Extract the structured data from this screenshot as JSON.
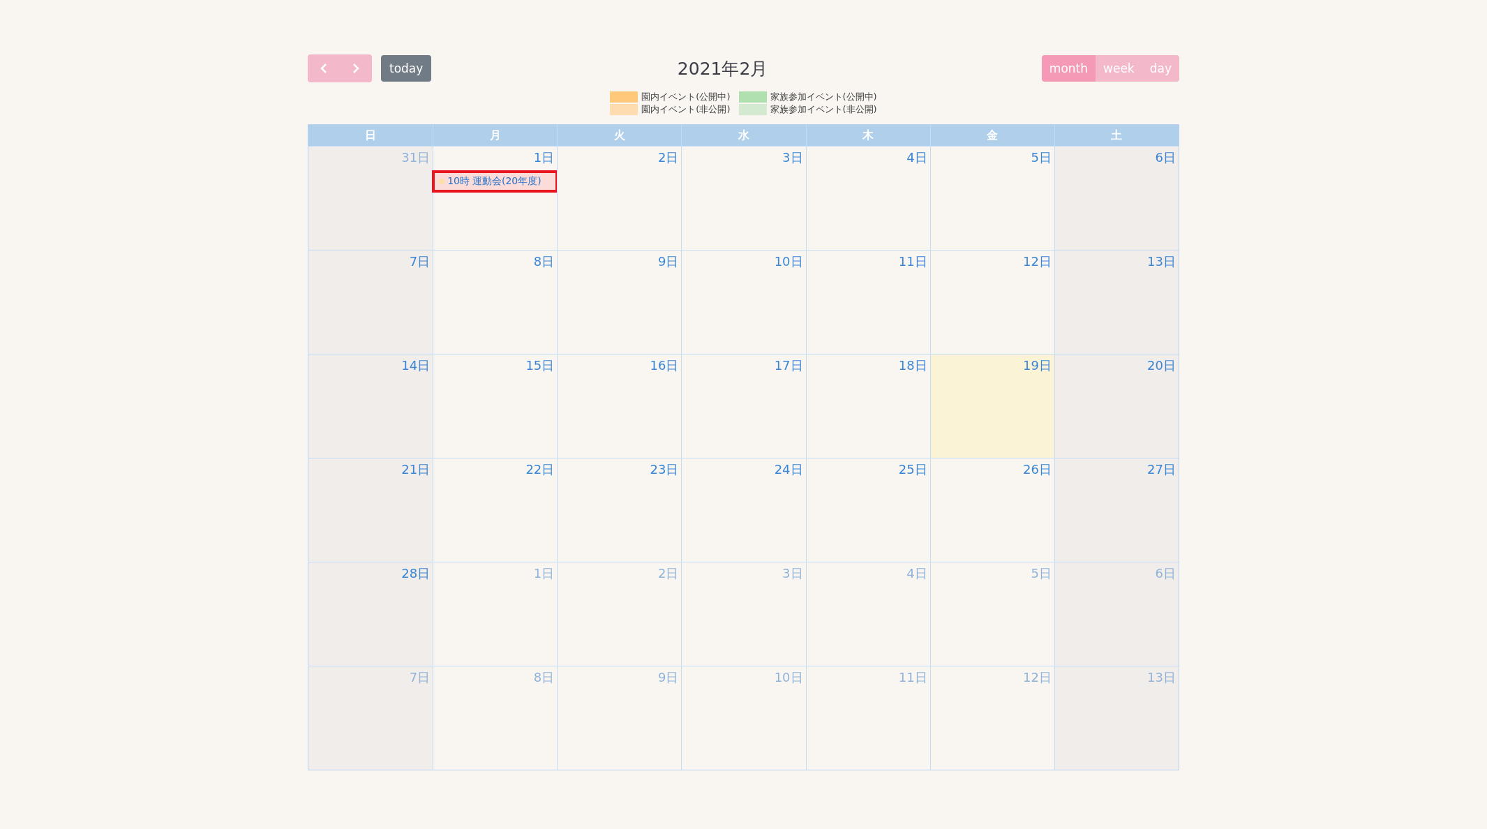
{
  "toolbar": {
    "today_button": "today",
    "title": "2021年2月",
    "views": [
      {
        "label": "month",
        "selected": true
      },
      {
        "label": "week",
        "selected": false
      },
      {
        "label": "day",
        "selected": false
      }
    ]
  },
  "legend": [
    {
      "label": "園内イベント(公開中)",
      "color": "#ffc87a"
    },
    {
      "label": "家族参加イベント(公開中)",
      "color": "#b0e0b0"
    },
    {
      "label": "園内イベント(非公開)",
      "color": "#fedcb0"
    },
    {
      "label": "家族参加イベント(非公開)",
      "color": "#d4ead0"
    }
  ],
  "weekdays": [
    "日",
    "月",
    "火",
    "水",
    "木",
    "金",
    "土"
  ],
  "weeks": [
    [
      {
        "day": "31日",
        "other_month": true,
        "today": false
      },
      {
        "day": "1日",
        "other_month": false,
        "today": false,
        "events": [
          {
            "time": "10時",
            "title": "運動会(20年度)",
            "color": "#fddfa8",
            "outlined": true
          }
        ]
      },
      {
        "day": "2日",
        "other_month": false,
        "today": false
      },
      {
        "day": "3日",
        "other_month": false,
        "today": false
      },
      {
        "day": "4日",
        "other_month": false,
        "today": false
      },
      {
        "day": "5日",
        "other_month": false,
        "today": false
      },
      {
        "day": "6日",
        "other_month": false,
        "today": false
      }
    ],
    [
      {
        "day": "7日",
        "other_month": false,
        "today": false
      },
      {
        "day": "8日",
        "other_month": false,
        "today": false
      },
      {
        "day": "9日",
        "other_month": false,
        "today": false
      },
      {
        "day": "10日",
        "other_month": false,
        "today": false
      },
      {
        "day": "11日",
        "other_month": false,
        "today": false
      },
      {
        "day": "12日",
        "other_month": false,
        "today": false
      },
      {
        "day": "13日",
        "other_month": false,
        "today": false
      }
    ],
    [
      {
        "day": "14日",
        "other_month": false,
        "today": false
      },
      {
        "day": "15日",
        "other_month": false,
        "today": false
      },
      {
        "day": "16日",
        "other_month": false,
        "today": false
      },
      {
        "day": "17日",
        "other_month": false,
        "today": false
      },
      {
        "day": "18日",
        "other_month": false,
        "today": false
      },
      {
        "day": "19日",
        "other_month": false,
        "today": true
      },
      {
        "day": "20日",
        "other_month": false,
        "today": false
      }
    ],
    [
      {
        "day": "21日",
        "other_month": false,
        "today": false
      },
      {
        "day": "22日",
        "other_month": false,
        "today": false
      },
      {
        "day": "23日",
        "other_month": false,
        "today": false
      },
      {
        "day": "24日",
        "other_month": false,
        "today": false
      },
      {
        "day": "25日",
        "other_month": false,
        "today": false
      },
      {
        "day": "26日",
        "other_month": false,
        "today": false
      },
      {
        "day": "27日",
        "other_month": false,
        "today": false
      }
    ],
    [
      {
        "day": "28日",
        "other_month": false,
        "today": false
      },
      {
        "day": "1日",
        "other_month": true,
        "today": false
      },
      {
        "day": "2日",
        "other_month": true,
        "today": false
      },
      {
        "day": "3日",
        "other_month": true,
        "today": false
      },
      {
        "day": "4日",
        "other_month": true,
        "today": false
      },
      {
        "day": "5日",
        "other_month": true,
        "today": false
      },
      {
        "day": "6日",
        "other_month": true,
        "today": false
      }
    ],
    [
      {
        "day": "7日",
        "other_month": true,
        "today": false
      },
      {
        "day": "8日",
        "other_month": true,
        "today": false
      },
      {
        "day": "9日",
        "other_month": true,
        "today": false
      },
      {
        "day": "10日",
        "other_month": true,
        "today": false
      },
      {
        "day": "11日",
        "other_month": true,
        "today": false
      },
      {
        "day": "12日",
        "other_month": true,
        "today": false
      },
      {
        "day": "13日",
        "other_month": true,
        "today": false
      }
    ]
  ]
}
